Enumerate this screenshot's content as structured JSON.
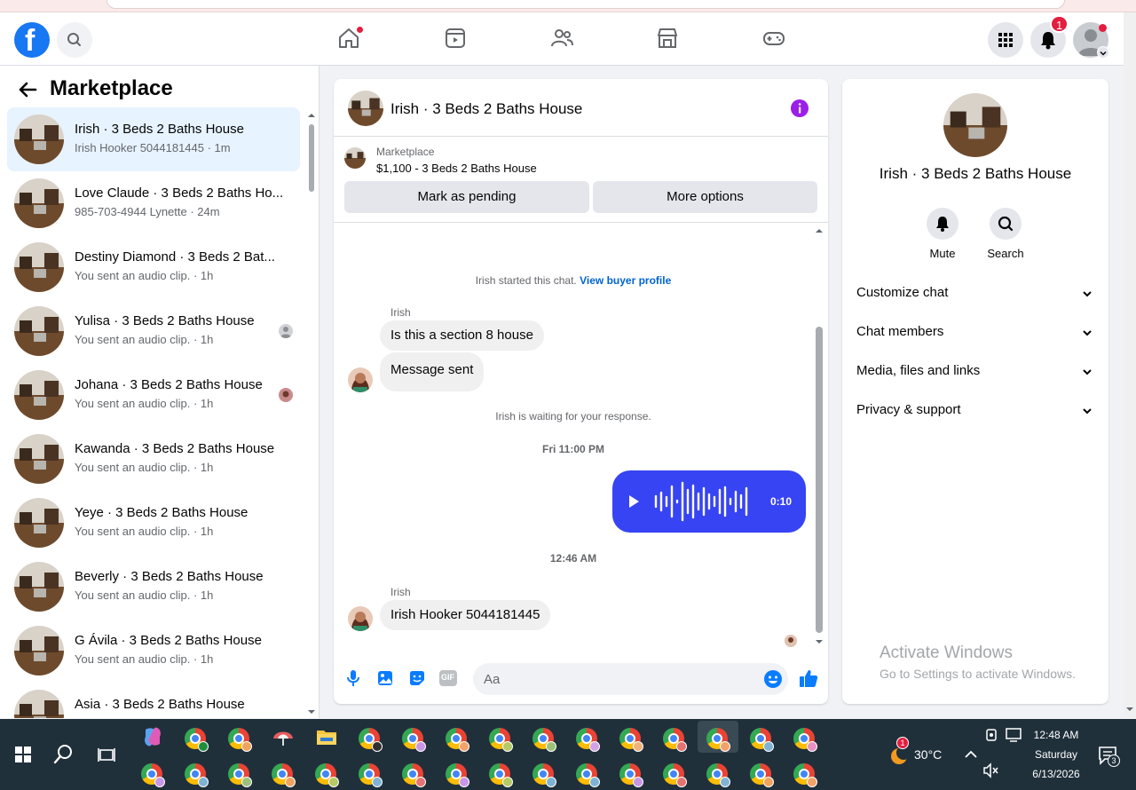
{
  "header": {
    "notifications_count": "1"
  },
  "sidebar": {
    "title": "Marketplace",
    "conversations": [
      {
        "name": "Irish · 3 Beds 2 Baths House",
        "sub": "Irish Hooker 5044181445 · 1m",
        "active": true
      },
      {
        "name": "Love Claude · 3 Beds 2 Baths Ho...",
        "sub": "985-703-4944 Lynette · 24m"
      },
      {
        "name": "Destiny Diamond · 3 Beds 2 Bat...",
        "sub": "You sent an audio clip. · 1h"
      },
      {
        "name": "Yulisa · 3 Beds 2 Baths House",
        "sub": "You sent an audio clip. · 1h"
      },
      {
        "name": "Johana · 3 Beds 2 Baths House",
        "sub": "You sent an audio clip. · 1h"
      },
      {
        "name": "Kawanda · 3 Beds 2 Baths House",
        "sub": "You sent an audio clip. · 1h"
      },
      {
        "name": "Yeye · 3 Beds 2 Baths House",
        "sub": "You sent an audio clip. · 1h"
      },
      {
        "name": "Beverly · 3 Beds 2 Baths House",
        "sub": "You sent an audio clip. · 1h"
      },
      {
        "name": "G Ávila · 3 Beds 2 Baths House",
        "sub": "You sent an audio clip. · 1h"
      },
      {
        "name": "Asia · 3 Beds 2 Baths House",
        "sub": ""
      }
    ]
  },
  "chat": {
    "title": "Irish · 3 Beds 2 Baths House",
    "listing_label": "Marketplace",
    "listing_value": "$1,100 - 3 Beds 2 Baths House",
    "mark_pending": "Mark as pending",
    "more_options": "More options",
    "started": "Irish started this chat.",
    "view_profile": "View buyer profile",
    "sender1": "Irish",
    "msg1": "Is this a section 8 house",
    "msg2": "Message sent",
    "waiting": "Irish is waiting for your response.",
    "stamp1": "Fri 11:00 PM",
    "audio_duration": "0:10",
    "stamp2": "12:46 AM",
    "sender2": "Irish",
    "msg3": "Irish Hooker 5044181445",
    "composer_placeholder": "Aa",
    "gif_label": "GIF"
  },
  "right": {
    "title": "Irish · 3 Beds 2 Baths House",
    "mute": "Mute",
    "search": "Search",
    "sections": [
      "Customize chat",
      "Chat members",
      "Media, files and links",
      "Privacy & support"
    ],
    "watermark_line1": "Activate Windows",
    "watermark_line2": "Go to Settings to activate Windows."
  },
  "taskbar": {
    "temperature": "30°C",
    "weather_alert": "1",
    "time": "12:48 AM",
    "day": "Saturday",
    "date": "6/13/2026",
    "notif_count": "3"
  },
  "colors": {
    "fb_blue": "#1877f2",
    "audio_bubble": "#3744f3",
    "info_purple": "#9b1fe8",
    "badge_red": "#e41e3f"
  }
}
